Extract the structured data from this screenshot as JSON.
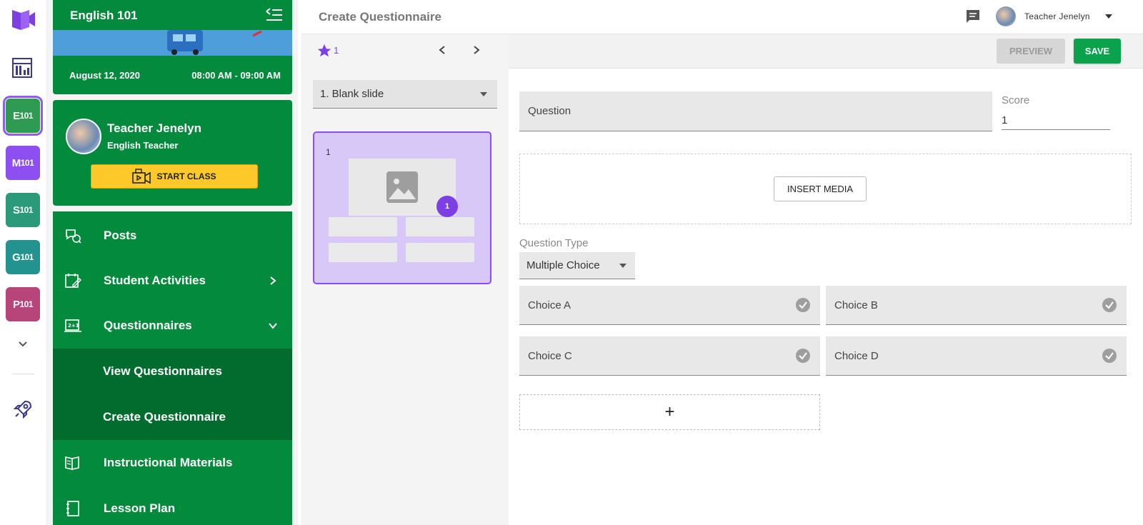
{
  "rail": {
    "courses": [
      {
        "prefix": "E",
        "suffix": "101",
        "color": "#2e9a52"
      },
      {
        "prefix": "M",
        "suffix": "101",
        "color": "#8e4ff0"
      },
      {
        "prefix": "S",
        "suffix": "101",
        "color": "#2a9a7a"
      },
      {
        "prefix": "G",
        "suffix": "101",
        "color": "#23938f"
      },
      {
        "prefix": "P",
        "suffix": "101",
        "color": "#b8457a"
      }
    ]
  },
  "sidebar": {
    "course_title": "English 101",
    "date": "August 12, 2020",
    "time": "08:00 AM - 09:00 AM",
    "teacher_name": "Teacher Jenelyn",
    "teacher_role": "English Teacher",
    "start_class_label": "START CLASS",
    "nav": [
      {
        "label": "Posts"
      },
      {
        "label": "Student Activities"
      },
      {
        "label": "Questionnaires"
      },
      {
        "label": "View Questionnaires"
      },
      {
        "label": "Create Questionnaire"
      },
      {
        "label": "Instructional Materials"
      },
      {
        "label": "Lesson Plan"
      }
    ]
  },
  "header": {
    "page_title": "Create Questionnaire",
    "user_name": "Teacher Jenelyn"
  },
  "slides": {
    "star_count": "1",
    "selected_slide": "1. Blank slide",
    "thumb_number": "1",
    "thumb_badge": "1"
  },
  "editor": {
    "preview_label": "PREVIEW",
    "save_label": "SAVE",
    "question_placeholder": "Question",
    "score_label": "Score",
    "score_value": "1",
    "insert_media_label": "INSERT MEDIA",
    "question_type_label": "Question Type",
    "question_type_value": "Multiple Choice",
    "choices": [
      "Choice A",
      "Choice B",
      "Choice C",
      "Choice D"
    ],
    "add_choice_label": "+"
  },
  "colors": {
    "sidebar_green": "#038a3c",
    "sidebar_green_dark": "#016c2e",
    "accent_purple": "#7b3fe4",
    "save_green": "#0aa24a",
    "start_yellow": "#fcc82a"
  }
}
